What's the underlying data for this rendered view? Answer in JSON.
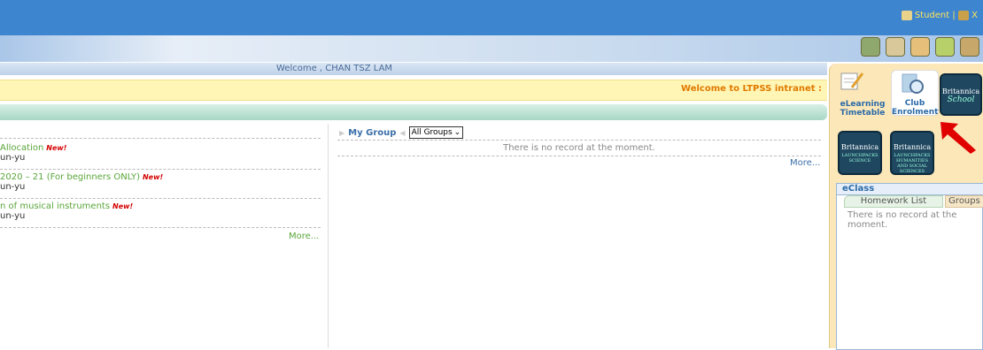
{
  "header": {
    "user_label": "Student",
    "logout_label": "X"
  },
  "toolbar": {
    "icons": [
      "calendar-icon",
      "clipboard-icon",
      "hands-icon",
      "palette-icon",
      "tools-icon"
    ]
  },
  "welcome": {
    "text": "Welcome , CHAN TSZ LAM"
  },
  "marquee": {
    "text": "Welcome to LTPSS intranet :"
  },
  "news": {
    "items": [
      {
        "title": "Allocation",
        "new": "New!",
        "author": "un-yu"
      },
      {
        "title": "2020 – 21 (For beginners ONLY)",
        "new": "New!",
        "author": "un-yu"
      },
      {
        "title": "n of musical instruments",
        "new": "New!",
        "author": "un-yu"
      }
    ],
    "more_label": "More..."
  },
  "group": {
    "label": "My Group",
    "select_value": "All Groups",
    "empty_text": "There is no record at the moment.",
    "more_label": "More..."
  },
  "sidebar": {
    "tiles": [
      {
        "label1": "eLearning",
        "label2": "Timetable"
      },
      {
        "label1": "Club",
        "label2": "Enrolment"
      }
    ],
    "britannica_school": {
      "brand": "Britannica",
      "sub": "School"
    },
    "launchpacks": [
      {
        "brand": "Britannica",
        "sub": "LAUNCHPACKS SCIENCE"
      },
      {
        "brand": "Britannica",
        "sub": "LAUNCHPACKS HUMANITIES AND SOCIAL SCIENCES"
      }
    ],
    "eclass": {
      "title": "eClass",
      "tab_homework": "Homework List",
      "tab_groups": "Groups",
      "empty_text": "There is no record at the moment."
    }
  },
  "colors": {
    "topbar": "#3d85cf",
    "accent_green": "#5aa63a",
    "link_blue": "#3a6fa8",
    "marquee_text": "#e07a00",
    "panel": "#fbe7b8",
    "highlight_arrow": "#e00000"
  }
}
